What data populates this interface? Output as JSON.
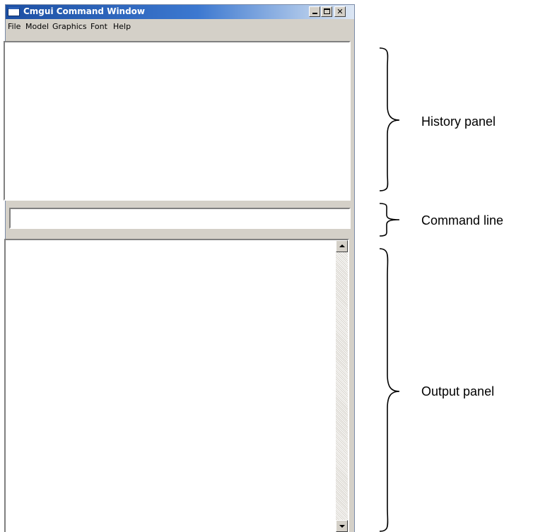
{
  "window": {
    "title": "Cmgui Command Window",
    "title_buttons": {
      "minimize": "minimize",
      "maximize": "maximize",
      "close": "✕"
    }
  },
  "menu": {
    "items": [
      "File",
      "Model",
      "Graphics",
      "Font",
      "Help"
    ]
  },
  "panels": {
    "history": "",
    "command_line": "",
    "output": ""
  },
  "annotations": {
    "history": "History panel",
    "command": "Command line",
    "output": "Output panel"
  }
}
